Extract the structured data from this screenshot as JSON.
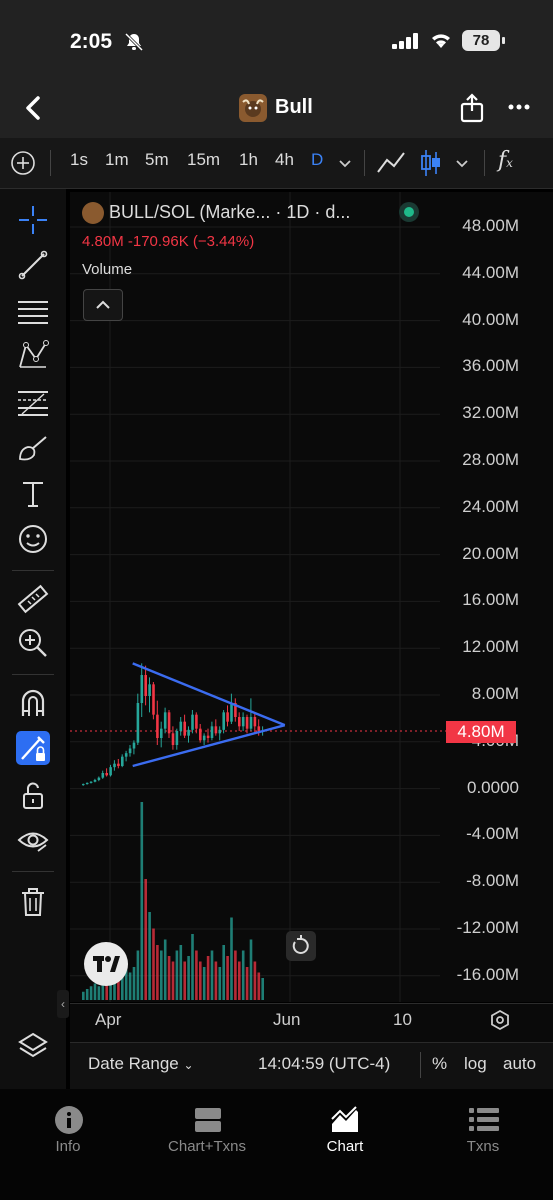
{
  "status_bar": {
    "time": "2:05",
    "battery": "78"
  },
  "header": {
    "title": "Bull"
  },
  "toolbar": {
    "intervals": [
      "1s",
      "1m",
      "5m",
      "15m",
      "1h",
      "4h",
      "D"
    ],
    "active_interval": "D",
    "indicators_icon": "fx-icon"
  },
  "chart_info": {
    "symbol": "BULL/SOL (Marke... · 1D · d...",
    "price_change": "4.80M  -170.96K  (−3.44%)",
    "volume_label": "Volume"
  },
  "chart_data": {
    "type": "candlestick",
    "y_ticks": [
      "48.00M",
      "44.00M",
      "40.00M",
      "36.00M",
      "32.00M",
      "28.00M",
      "24.00M",
      "20.00M",
      "16.00M",
      "12.00M",
      "8.00M",
      "4.00M",
      "0.0000",
      "-4.00M",
      "-8.00M",
      "-12.00M",
      "-16.00M"
    ],
    "x_ticks": [
      "Apr",
      "Jun",
      "10"
    ],
    "current_price_label": "4.80M",
    "colors": {
      "up": "#26a69a",
      "down": "#f23645",
      "trendline": "#3b6cf0"
    },
    "candles": [
      {
        "o": 0.2,
        "h": 0.3,
        "l": 0.1,
        "c": 0.25
      },
      {
        "o": 0.25,
        "h": 0.4,
        "l": 0.2,
        "c": 0.35
      },
      {
        "o": 0.35,
        "h": 0.5,
        "l": 0.3,
        "c": 0.45
      },
      {
        "o": 0.45,
        "h": 0.7,
        "l": 0.4,
        "c": 0.6
      },
      {
        "o": 0.6,
        "h": 0.9,
        "l": 0.5,
        "c": 0.8
      },
      {
        "o": 0.8,
        "h": 1.4,
        "l": 0.7,
        "c": 1.2
      },
      {
        "o": 1.2,
        "h": 1.6,
        "l": 0.9,
        "c": 1.0
      },
      {
        "o": 1.0,
        "h": 1.9,
        "l": 0.9,
        "c": 1.7
      },
      {
        "o": 1.7,
        "h": 2.3,
        "l": 1.4,
        "c": 2.0
      },
      {
        "o": 2.0,
        "h": 2.4,
        "l": 1.6,
        "c": 1.8
      },
      {
        "o": 1.8,
        "h": 2.8,
        "l": 1.7,
        "c": 2.6
      },
      {
        "o": 2.6,
        "h": 3.1,
        "l": 2.2,
        "c": 2.9
      },
      {
        "o": 2.9,
        "h": 3.6,
        "l": 2.6,
        "c": 3.3
      },
      {
        "o": 3.3,
        "h": 4.0,
        "l": 2.8,
        "c": 3.8
      },
      {
        "o": 3.8,
        "h": 8.0,
        "l": 3.6,
        "c": 7.2
      },
      {
        "o": 7.2,
        "h": 10.6,
        "l": 6.0,
        "c": 9.6
      },
      {
        "o": 9.6,
        "h": 10.4,
        "l": 7.0,
        "c": 7.8
      },
      {
        "o": 7.8,
        "h": 9.4,
        "l": 6.4,
        "c": 8.8
      },
      {
        "o": 8.8,
        "h": 9.0,
        "l": 5.8,
        "c": 6.2
      },
      {
        "o": 6.2,
        "h": 7.4,
        "l": 3.6,
        "c": 4.2
      },
      {
        "o": 4.2,
        "h": 5.6,
        "l": 3.4,
        "c": 5.0
      },
      {
        "o": 5.0,
        "h": 6.8,
        "l": 4.6,
        "c": 6.4
      },
      {
        "o": 6.4,
        "h": 6.6,
        "l": 4.2,
        "c": 4.6
      },
      {
        "o": 4.6,
        "h": 5.2,
        "l": 3.2,
        "c": 3.6
      },
      {
        "o": 3.6,
        "h": 5.0,
        "l": 3.2,
        "c": 4.8
      },
      {
        "o": 4.8,
        "h": 6.0,
        "l": 4.4,
        "c": 5.6
      },
      {
        "o": 5.6,
        "h": 6.2,
        "l": 4.2,
        "c": 4.4
      },
      {
        "o": 4.4,
        "h": 5.2,
        "l": 3.8,
        "c": 4.9
      },
      {
        "o": 4.9,
        "h": 6.6,
        "l": 4.6,
        "c": 6.2
      },
      {
        "o": 6.2,
        "h": 6.4,
        "l": 4.6,
        "c": 5.0
      },
      {
        "o": 5.0,
        "h": 5.4,
        "l": 3.8,
        "c": 4.0
      },
      {
        "o": 4.0,
        "h": 4.6,
        "l": 3.6,
        "c": 4.4
      },
      {
        "o": 4.4,
        "h": 5.0,
        "l": 3.8,
        "c": 4.2
      },
      {
        "o": 4.2,
        "h": 5.6,
        "l": 4.0,
        "c": 5.2
      },
      {
        "o": 5.2,
        "h": 5.8,
        "l": 4.4,
        "c": 4.6
      },
      {
        "o": 4.6,
        "h": 5.2,
        "l": 4.0,
        "c": 4.9
      },
      {
        "o": 4.9,
        "h": 6.6,
        "l": 4.6,
        "c": 6.4
      },
      {
        "o": 6.4,
        "h": 7.0,
        "l": 5.2,
        "c": 5.6
      },
      {
        "o": 5.6,
        "h": 8.0,
        "l": 5.4,
        "c": 7.2
      },
      {
        "o": 7.2,
        "h": 7.6,
        "l": 5.6,
        "c": 6.0
      },
      {
        "o": 6.0,
        "h": 6.4,
        "l": 4.8,
        "c": 5.2
      },
      {
        "o": 5.2,
        "h": 6.4,
        "l": 4.8,
        "c": 6.0
      },
      {
        "o": 6.0,
        "h": 6.2,
        "l": 4.6,
        "c": 5.0
      },
      {
        "o": 5.0,
        "h": 7.6,
        "l": 4.8,
        "c": 6.0
      },
      {
        "o": 6.0,
        "h": 6.4,
        "l": 4.6,
        "c": 5.2
      },
      {
        "o": 5.2,
        "h": 5.8,
        "l": 4.4,
        "c": 4.8
      },
      {
        "o": 4.8,
        "h": 5.2,
        "l": 4.4,
        "c": 4.8
      }
    ],
    "volumes": [
      0.15,
      0.2,
      0.25,
      0.3,
      0.25,
      0.35,
      0.3,
      0.4,
      0.45,
      0.35,
      0.5,
      0.55,
      0.5,
      0.6,
      0.9,
      3.6,
      2.2,
      1.6,
      1.3,
      1.0,
      0.9,
      1.1,
      0.8,
      0.7,
      0.9,
      1.0,
      0.7,
      0.8,
      1.2,
      0.9,
      0.7,
      0.6,
      0.8,
      0.9,
      0.7,
      0.6,
      1.0,
      0.8,
      1.5,
      0.9,
      0.7,
      0.9,
      0.6,
      1.1,
      0.7,
      0.5,
      0.4
    ],
    "trendlines": [
      {
        "from": {
          "bar": 13,
          "value": 10.6
        },
        "to": {
          "bar": 52,
          "value": 5.3
        }
      },
      {
        "from": {
          "bar": 13,
          "value": 1.8
        },
        "to": {
          "bar": 52,
          "value": 5.3
        }
      }
    ],
    "current_price": 4.8
  },
  "chart_controls": {
    "date_range": "Date Range",
    "time": "14:04:59 (UTC-4)",
    "percent": "%",
    "log": "log",
    "auto": "auto"
  },
  "tabs": [
    {
      "label": "Info",
      "icon": "info-icon"
    },
    {
      "label": "Chart+Txns",
      "icon": "split-view-icon"
    },
    {
      "label": "Chart",
      "icon": "chart-icon"
    },
    {
      "label": "Txns",
      "icon": "list-icon"
    }
  ],
  "active_tab": "Chart"
}
